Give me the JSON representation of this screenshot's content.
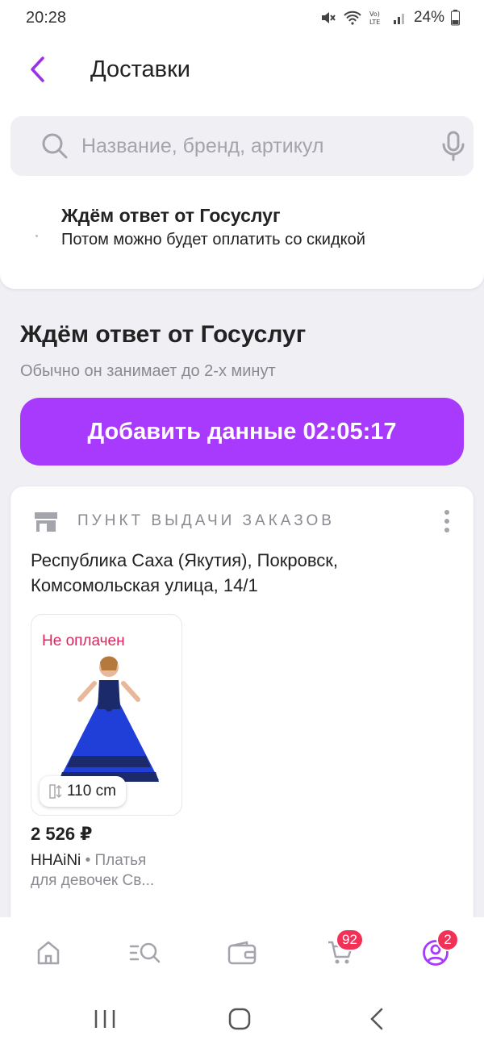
{
  "status_bar": {
    "time": "20:28",
    "battery": "24%"
  },
  "header": {
    "title": "Доставки"
  },
  "search": {
    "placeholder": "Название, бренд, артикул"
  },
  "notice": {
    "title": "Ждём ответ от Госуслуг",
    "subtitle": "Потом можно будет оплатить со скидкой"
  },
  "wait": {
    "title": "Ждём ответ от Госуслуг",
    "subtitle": "Обычно он занимает до 2-х минут"
  },
  "add_button": {
    "label": "Добавить данные 02:05:17"
  },
  "delivery": {
    "type_label": "ПУНКТ ВЫДАЧИ ЗАКАЗОВ",
    "address_line1": "Республика Саха (Якутия), Покровск,",
    "address_line2": "Комсомольская улица, 14/1",
    "product": {
      "status": "Не оплачен",
      "size": "110 cm",
      "price": "2 526 ₽",
      "brand": "HHAiNi",
      "category": "• Платья для девочек Св..."
    }
  },
  "bottom_nav": {
    "cart_badge": "92",
    "profile_badge": "2"
  },
  "colors": {
    "accent": "#a73afd",
    "badge": "#f23157",
    "unpaid": "#e0245e"
  }
}
